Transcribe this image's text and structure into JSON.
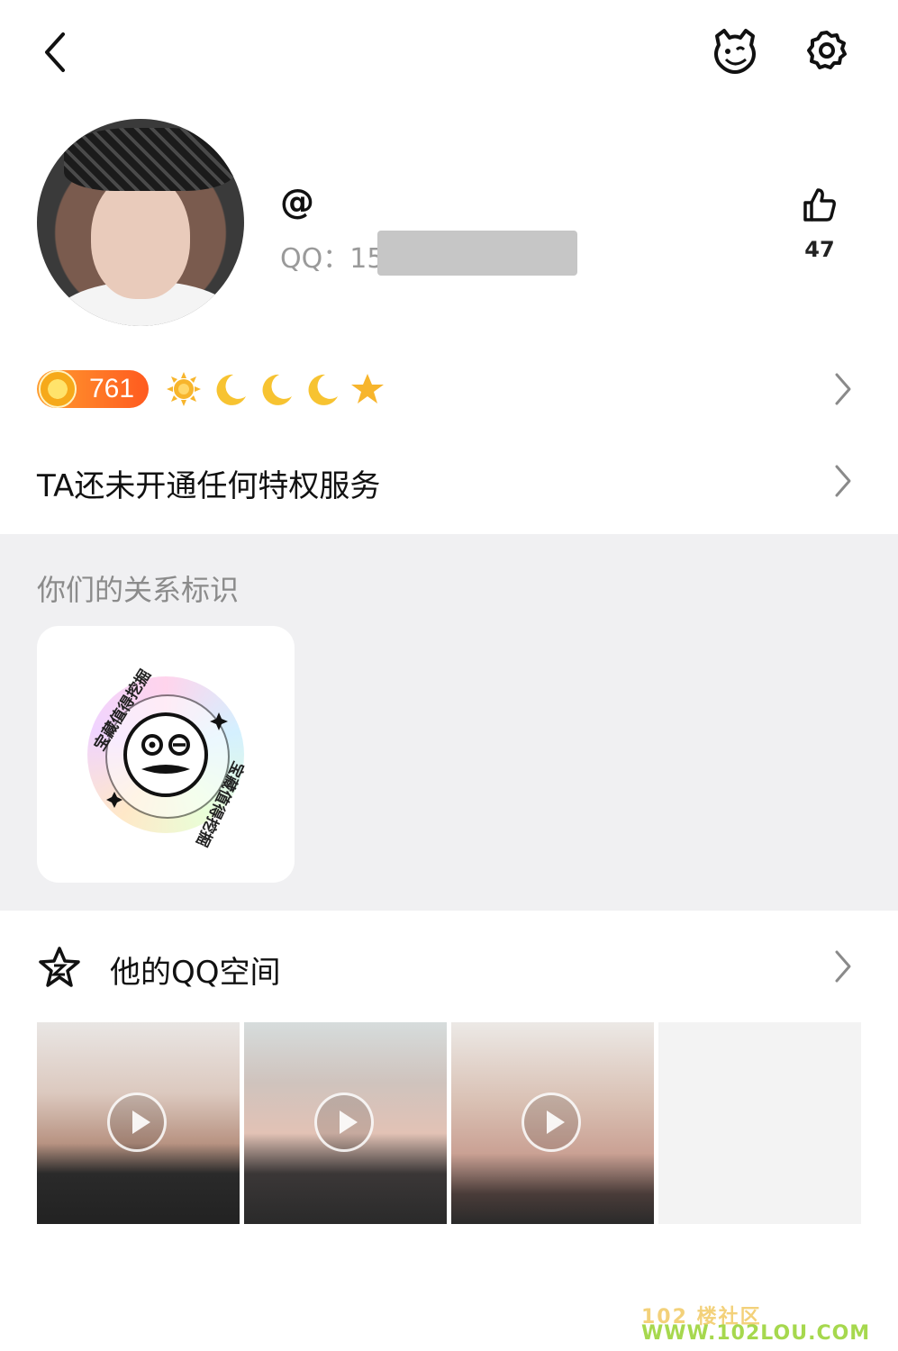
{
  "profile": {
    "at_sign": "@",
    "qq_label": "QQ：15",
    "likes": "47"
  },
  "level": {
    "value": "761",
    "icons": [
      "sun-icon",
      "moon-icon",
      "moon-icon",
      "moon-icon",
      "star-icon"
    ]
  },
  "privilege": {
    "text": "TA还未开通任何特权服务"
  },
  "relation": {
    "title": "你们的关系标识",
    "badge_text": "宝藏值得挖掘"
  },
  "qzone": {
    "title": "他的QQ空间",
    "thumbnails": [
      {
        "type": "video"
      },
      {
        "type": "video"
      },
      {
        "type": "video"
      },
      {
        "type": "empty"
      }
    ]
  },
  "watermark": {
    "line1": "102 楼社区",
    "line2": "WWW.102LOU.COM"
  },
  "colors": {
    "level_badge": "#ff6a1f",
    "grey_bg": "#f0f0f2",
    "muted_text": "#8b8b8b"
  }
}
